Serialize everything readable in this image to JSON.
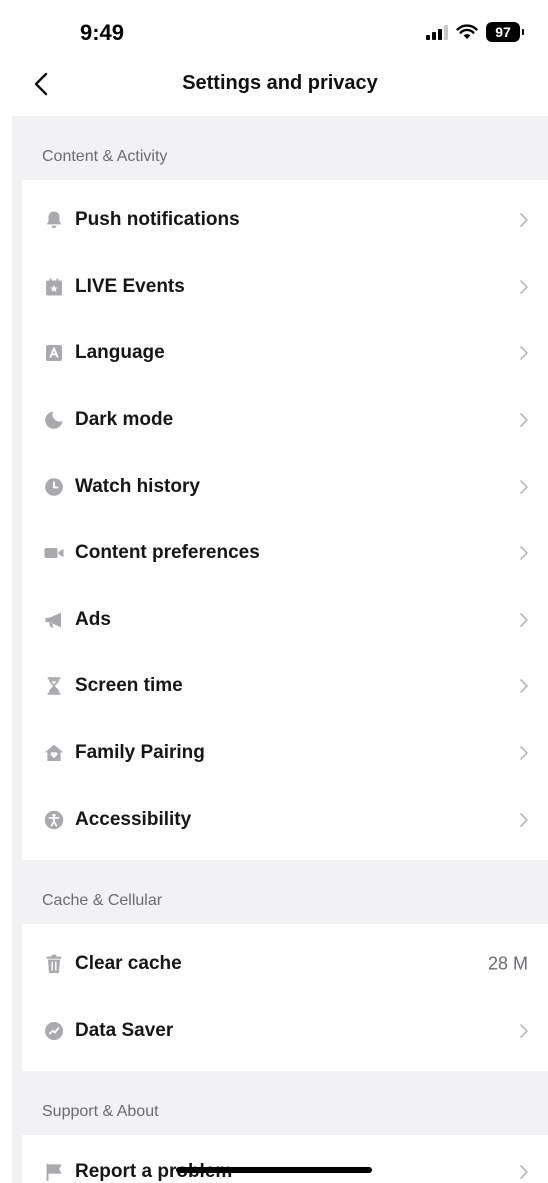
{
  "status_bar": {
    "time": "9:49",
    "battery": "97"
  },
  "header": {
    "title": "Settings and privacy"
  },
  "sections": [
    {
      "title": "Content & Activity",
      "items": [
        {
          "label": "Push notifications",
          "icon": "bell-icon"
        },
        {
          "label": "LIVE Events",
          "icon": "calendar-icon"
        },
        {
          "label": "Language",
          "icon": "language-icon"
        },
        {
          "label": "Dark mode",
          "icon": "moon-icon"
        },
        {
          "label": "Watch history",
          "icon": "clock-icon"
        },
        {
          "label": "Content preferences",
          "icon": "video-camera-icon"
        },
        {
          "label": "Ads",
          "icon": "megaphone-icon"
        },
        {
          "label": "Screen time",
          "icon": "hourglass-icon"
        },
        {
          "label": "Family Pairing",
          "icon": "house-heart-icon"
        },
        {
          "label": "Accessibility",
          "icon": "accessibility-icon"
        }
      ]
    },
    {
      "title": "Cache & Cellular",
      "items": [
        {
          "label": "Clear cache",
          "icon": "trash-icon",
          "value": "28 M"
        },
        {
          "label": "Data Saver",
          "icon": "data-saver-icon"
        }
      ]
    },
    {
      "title": "Support & About",
      "items": [
        {
          "label": "Report a problem",
          "icon": "flag-icon"
        }
      ]
    }
  ],
  "colors": {
    "icon": "#a9a9ae",
    "chevron": "#b9b9be",
    "section_text": "#6b6b70",
    "background": "#f2f2f4"
  }
}
